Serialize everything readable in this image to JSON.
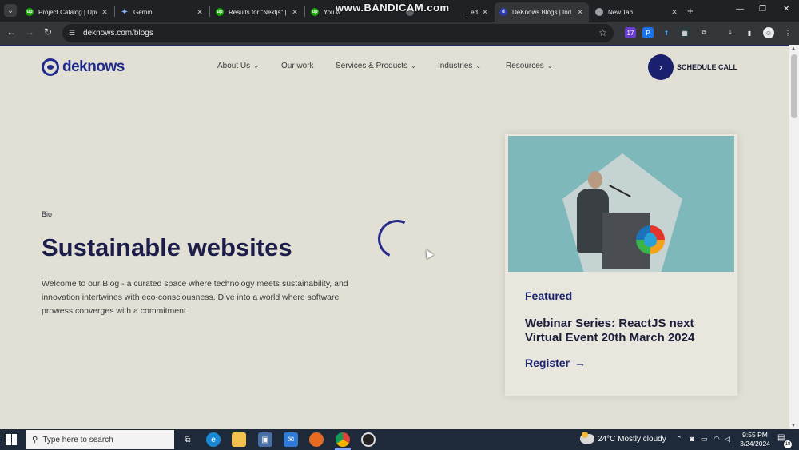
{
  "browser": {
    "tabs": [
      {
        "label": "Project Catalog | Upw",
        "icon": "upwork-icon",
        "active": false
      },
      {
        "label": "Gemini",
        "icon": "gemini-icon",
        "active": false
      },
      {
        "label": "Results for \"Nextjs\" |",
        "icon": "upwork-icon",
        "active": false
      },
      {
        "label": "You w",
        "icon": "upwork-icon",
        "active": false
      },
      {
        "label": "...ed",
        "icon": "doc-icon",
        "active": false
      },
      {
        "label": "DeKnows Blogs | Ind",
        "icon": "deknows-icon",
        "active": true
      },
      {
        "label": "New Tab",
        "icon": "chrome-icon",
        "active": false
      }
    ],
    "watermark": "www.BANDICAM.com",
    "url": "deknows.com/blogs"
  },
  "site": {
    "brand": "deknows",
    "nav": [
      {
        "label": "About Us",
        "has_dropdown": true
      },
      {
        "label": "Our work",
        "has_dropdown": false
      },
      {
        "label": "Services & Products",
        "has_dropdown": true
      },
      {
        "label": "Industries",
        "has_dropdown": true
      },
      {
        "label": "Resources",
        "has_dropdown": true
      }
    ],
    "cta": "SCHEDULE CALL",
    "colors": {
      "brand": "#1f2a8c",
      "heading": "#1c1d4a",
      "background": "#e2e0d5"
    }
  },
  "hero": {
    "eyebrow": "Bio",
    "title": "Sustainable websites",
    "description": "Welcome to our Blog - a curated space where technology meets sustainability, and innovation intertwines with eco-consciousness. Dive into a world where software prowess converges with a commitment"
  },
  "featured_card": {
    "tag": "Featured",
    "title": "Webinar Series: ReactJS next Virtual Event 20th March 2024",
    "cta": "Register"
  },
  "taskbar": {
    "search_placeholder": "Type here to search",
    "weather": "24°C  Mostly cloudy",
    "time": "9:55 PM",
    "date": "3/24/2024",
    "notification_count": "18"
  }
}
